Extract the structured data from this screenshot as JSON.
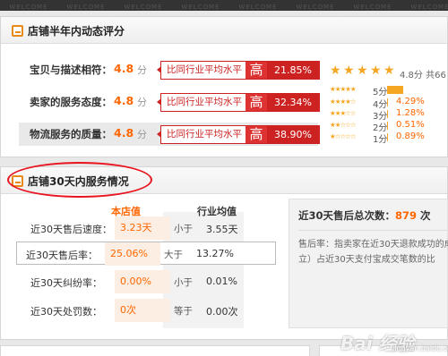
{
  "topbar": {
    "items": [
      "WELCOME",
      "WELCOME",
      "WELCOME",
      "WELCOME",
      "WELCOME",
      "WELCOME",
      "WELCOME",
      "WELCOME"
    ]
  },
  "dsr": {
    "title": "店铺半年内动态评分",
    "rows": [
      {
        "label": "宝贝与描述相符：",
        "score": "4.8",
        "unit": "分",
        "compare_label": "比同行业平均水平",
        "direction": "高",
        "percent": "21.85%"
      },
      {
        "label": "卖家的服务态度：",
        "score": "4.8",
        "unit": "分",
        "compare_label": "比同行业平均水平",
        "direction": "高",
        "percent": "32.34%"
      },
      {
        "label": "物流服务的质量：",
        "score": "4.8",
        "unit": "分",
        "compare_label": "比同行业平均水平",
        "direction": "高",
        "percent": "38.90%"
      }
    ],
    "summary": {
      "avg": "4.8分",
      "total_prefix": "共66"
    },
    "distribution": [
      {
        "label": "5分",
        "percent": "",
        "fraction": 0.9
      },
      {
        "label": "4分",
        "percent": "4.29%",
        "fraction": 0.0429
      },
      {
        "label": "3分",
        "percent": "1.28%",
        "fraction": 0.0128
      },
      {
        "label": "2分",
        "percent": "0.51%",
        "fraction": 0.0051
      },
      {
        "label": "1分",
        "percent": "0.89%",
        "fraction": 0.0089
      }
    ]
  },
  "service": {
    "title": "店铺30天内服务情况",
    "col_store": "本店值",
    "col_avg": "行业均值",
    "rows": [
      {
        "label": "近30天售后速度：",
        "value": "3.23天",
        "cmp": "小于",
        "avg": "3.55天"
      },
      {
        "label": "近30天售后率：",
        "value": "25.06%",
        "cmp": "大于",
        "avg": "13.27%"
      },
      {
        "label": "近30天纠纷率：",
        "value": "0.00%",
        "cmp": "小于",
        "avg": "0.01%"
      },
      {
        "label": "近30天处罚数：",
        "value": "0次",
        "cmp": "等于",
        "avg": "0.00次"
      }
    ],
    "detail": {
      "title_prefix": "近30天售后总次数：",
      "count": "879",
      "count_unit": " 次",
      "desc": "售后率：指卖家在近30天退款成功的成立）占近30天支付宝成交笔数的比"
    }
  },
  "colors": {
    "accent": "#ff6600",
    "red": "#cc2222",
    "star": "#f5a623"
  },
  "watermark": {
    "main": "Bai 经验",
    "sub": "jingyan.baidu.com"
  }
}
